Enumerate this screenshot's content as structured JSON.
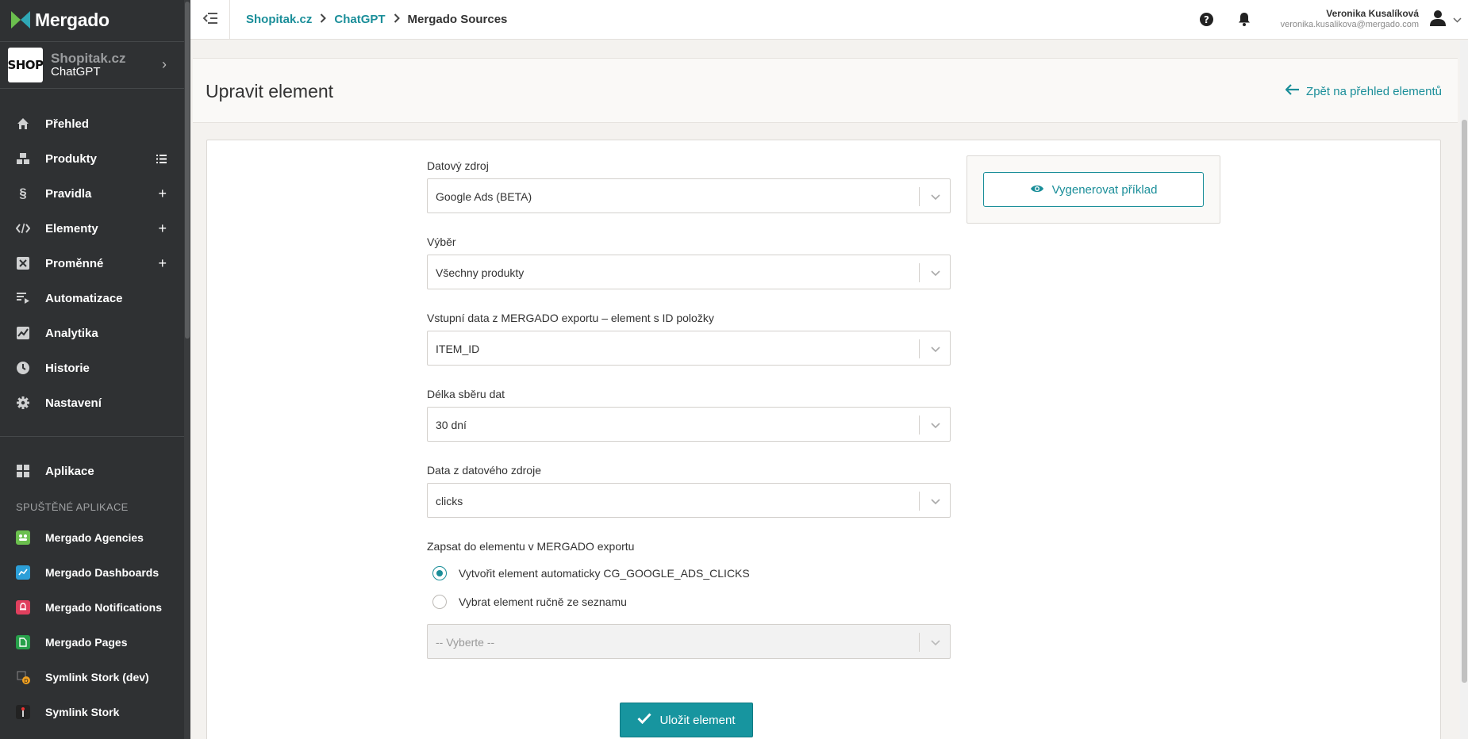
{
  "app": {
    "name": "Mergado"
  },
  "shop": {
    "logo_text": "SHOP",
    "name": "Shopitak.cz",
    "project": "ChatGPT"
  },
  "nav": [
    {
      "label": "Přehled",
      "icon": "home-icon",
      "action": ""
    },
    {
      "label": "Produkty",
      "icon": "cubes-icon",
      "action": "list-icon"
    },
    {
      "label": "Pravidla",
      "icon": "section-icon",
      "action": "plus-icon"
    },
    {
      "label": "Elementy",
      "icon": "code-icon",
      "action": "plus-icon"
    },
    {
      "label": "Proměnné",
      "icon": "variable-icon",
      "action": "plus-icon"
    },
    {
      "label": "Automatizace",
      "icon": "automation-icon",
      "action": ""
    },
    {
      "label": "Analytika",
      "icon": "chart-icon",
      "action": ""
    },
    {
      "label": "Historie",
      "icon": "history-icon",
      "action": ""
    },
    {
      "label": "Nastavení",
      "icon": "gear-icon",
      "action": ""
    }
  ],
  "apps_link": {
    "label": "Aplikace"
  },
  "running_apps_heading": "SPUŠTĚNÉ APLIKACE",
  "running_apps": [
    {
      "label": "Mergado Agencies",
      "color": "#6bbf4e"
    },
    {
      "label": "Mergado Dashboards",
      "color": "#2c9fd8"
    },
    {
      "label": "Mergado Notifications",
      "color": "#e0405e"
    },
    {
      "label": "Mergado Pages",
      "color": "#27a04a"
    },
    {
      "label": "Symlink Stork (dev)",
      "color": "#3a3c3e"
    },
    {
      "label": "Symlink Stork",
      "color": "#222222"
    }
  ],
  "breadcrumb": {
    "item1": "Shopitak.cz",
    "item2": "ChatGPT",
    "current": "Mergado Sources"
  },
  "user": {
    "name": "Veronika Kusalíková",
    "email": "veronika.kusalikova@mergado.com"
  },
  "page": {
    "title": "Upravit element",
    "back_label": "Zpět na přehled elementů"
  },
  "form": {
    "fields": [
      {
        "label": "Datový zdroj",
        "value": "Google Ads (BETA)"
      },
      {
        "label": "Výběr",
        "value": "Všechny produkty"
      },
      {
        "label": "Vstupní data z MERGADO exportu – element s ID položky",
        "value": "ITEM_ID"
      },
      {
        "label": "Délka sběru dat",
        "value": "30 dní"
      },
      {
        "label": "Data z datového zdroje",
        "value": "clicks"
      }
    ],
    "write_label": "Zapsat do elementu v MERGADO exportu",
    "radio_auto": "Vytvořit element automaticky CG_GOOGLE_ADS_CLICKS",
    "radio_manual": "Vybrat element ručně ze seznamu",
    "manual_select_placeholder": "-- Vyberte --",
    "save_label": "Uložit element"
  },
  "side": {
    "generate_label": "Vygenerovat příklad"
  },
  "colors": {
    "accent": "#1a8e99",
    "sidebar": "#2f3133"
  }
}
